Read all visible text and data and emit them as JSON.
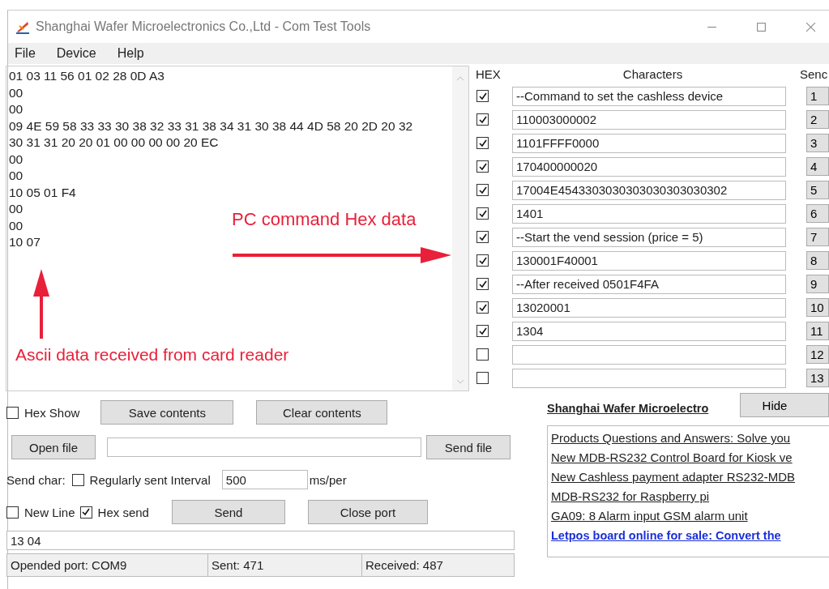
{
  "window": {
    "title": "Shanghai Wafer Microelectronics Co.,Ltd - Com Test Tools"
  },
  "menu": [
    {
      "label": "File"
    },
    {
      "label": "Device"
    },
    {
      "label": "Help"
    }
  ],
  "received_log": {
    "lines": [
      "01 03 11 56 01 02 28 0D A3",
      "00",
      "00",
      "09 4E 59 58 33 33 30 38 32 33 31 38 34 31 30 38 44 4D 58 20 2D 20 32",
      "30 31 31 20 20 01 00 00 00 00 20 EC",
      "00",
      "00",
      "10 05 01 F4",
      "00",
      "00",
      "10 07"
    ]
  },
  "annotations": [
    {
      "kind": "right-arrow",
      "text": "PC command Hex data"
    },
    {
      "kind": "up-arrow",
      "text": "Ascii data received from card reader"
    }
  ],
  "commands": {
    "columns": [
      "HEX",
      "Characters",
      "Senc"
    ],
    "rows": [
      {
        "hex": true,
        "text": "--Command to set the cashless device",
        "button": "1"
      },
      {
        "hex": true,
        "text": "110003000002",
        "button": "2"
      },
      {
        "hex": true,
        "text": "1101FFFF0000",
        "button": "3"
      },
      {
        "hex": true,
        "text": "170400000020",
        "button": "4"
      },
      {
        "hex": true,
        "text": "17004E4543303030303030303030302",
        "button": "5"
      },
      {
        "hex": true,
        "text": "1401",
        "button": "6"
      },
      {
        "hex": true,
        "text": "--Start the vend session (price = 5)",
        "button": "7"
      },
      {
        "hex": true,
        "text": "130001F40001",
        "button": "8"
      },
      {
        "hex": true,
        "text": "--After received 0501F4FA",
        "button": "9"
      },
      {
        "hex": true,
        "text": "13020001",
        "button": "10"
      },
      {
        "hex": true,
        "text": "1304",
        "button": "11"
      },
      {
        "hex": false,
        "text": "",
        "button": "12"
      },
      {
        "hex": false,
        "text": "",
        "button": "13"
      }
    ]
  },
  "hex_show": {
    "label": "Hex Show",
    "checked": false
  },
  "save_button": "Save contents",
  "clear_button": "Clear contents",
  "open_file_button": "Open file",
  "send_file_button": "Send file",
  "send_char_label": "Send char:",
  "regular_send": {
    "label": "Regularly sent Interval",
    "checked": false
  },
  "interval": {
    "value": "500",
    "unit": "ms/per"
  },
  "new_line": {
    "label": "New Line",
    "checked": false
  },
  "hex_send": {
    "label": "Hex send",
    "checked": true
  },
  "send_button": "Send",
  "close_port_button": "Close port",
  "send_input": {
    "value": "13 04"
  },
  "status_bar": [
    "Opended port:  COM9",
    "Sent:  471",
    "Received:  487"
  ],
  "news": {
    "title": "Shanghai Wafer Microelectro",
    "hide_button": "Hide",
    "links": [
      {
        "text": "Products Questions and Answers: Solve you",
        "highlighted": false
      },
      {
        "text": "New MDB-RS232 Control Board for Kiosk ve",
        "highlighted": false
      },
      {
        "text": "New Cashless payment adapter RS232-MDB",
        "highlighted": false
      },
      {
        "text": "MDB-RS232 for Raspberry pi",
        "highlighted": false
      },
      {
        "text": "GA09: 8 Alarm input GSM alarm unit",
        "highlighted": false
      },
      {
        "text": "Letpos board online for sale: Convert the",
        "highlighted": true
      }
    ]
  }
}
